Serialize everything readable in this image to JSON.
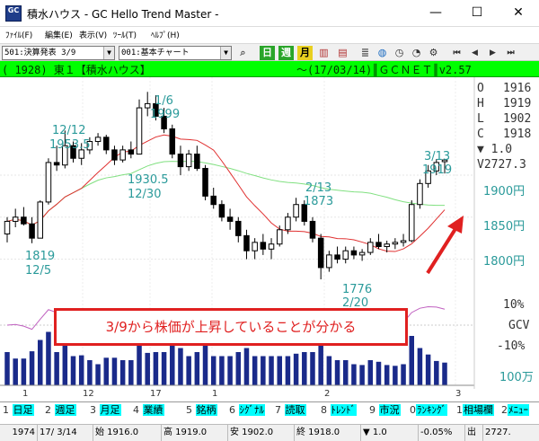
{
  "window": {
    "icon_text": "GC",
    "title": "積水ハウス - GC Hello Trend Master -",
    "minimize": "—",
    "maximize": "☐",
    "close": "✕"
  },
  "menu": {
    "file": "ﾌｧｲﾙ(F)",
    "edit": "編集(E)",
    "view": "表示(V)",
    "tools": "ﾂｰﾙ(T)",
    "help": "ﾍﾙﾌﾟ(H)"
  },
  "toolbar": {
    "list_select": "501:決算発表 3/9",
    "chart_select": "001:基本チャート",
    "day": "日",
    "week": "週",
    "month": "月",
    "nav_first": "⏮",
    "nav_prev": "◀",
    "nav_next": "▶",
    "nav_last": "⏭"
  },
  "infobar": {
    "code": "( 1928) 東１【積水ハウス】",
    "date": "〜(17/03/14)║ＧＣＮＥＴ║v2.57"
  },
  "chart": {
    "annotations": {
      "high_1": "12/12",
      "high_1_val": "1953.5",
      "peak": "1/6",
      "peak_val": "1999",
      "mid_val": "1930.5",
      "mid_date": "12/30",
      "feb13": "2/13",
      "feb13_val": "1873",
      "low_left_val": "1819",
      "low_left_date": "12/5",
      "low_feb_val": "1776",
      "low_feb_date": "2/20",
      "last": "3/13",
      "last_val": "1919"
    },
    "ohlc": {
      "o_label": "O",
      "o_val": "1916",
      "h_label": "H",
      "h_val": "1919",
      "l_label": "L",
      "l_val": "1902",
      "c_label": "C",
      "c_val": "1918",
      "change": "▼     1.0",
      "volume": "V2727.3"
    },
    "price_axis": [
      "1900円",
      "1850円",
      "1800円"
    ],
    "osc_axis": [
      "10%",
      "GCV",
      "-10%"
    ],
    "volume_unit": "100万",
    "time_axis": [
      "1",
      "12",
      "17",
      "1",
      "2",
      "3"
    ],
    "callout": "3/9から株価が上昇していることが分かる",
    "colors": {
      "up": "#ffffff",
      "down": "#000000",
      "ma_short": "#e03030",
      "ma_long": "#80e080",
      "volume": "#1a2a8a",
      "arrow": "#e02020"
    }
  },
  "chart_data": {
    "type": "candlestick",
    "series": [
      {
        "name": "ohlc",
        "values": [
          [
            1830,
            1850,
            1820,
            1845
          ],
          [
            1845,
            1860,
            1838,
            1850
          ],
          [
            1850,
            1862,
            1840,
            1842
          ],
          [
            1842,
            1850,
            1819,
            1825
          ],
          [
            1825,
            1870,
            1825,
            1868
          ],
          [
            1868,
            1920,
            1865,
            1915
          ],
          [
            1915,
            1935,
            1905,
            1912
          ],
          [
            1912,
            1953,
            1908,
            1935
          ],
          [
            1935,
            1940,
            1915,
            1920
          ],
          [
            1920,
            1938,
            1912,
            1930
          ],
          [
            1930,
            1945,
            1925,
            1940
          ],
          [
            1940,
            1950,
            1935,
            1945
          ],
          [
            1945,
            1948,
            1925,
            1930
          ],
          [
            1930,
            1935,
            1912,
            1918
          ],
          [
            1918,
            1935,
            1915,
            1930
          ],
          [
            1930,
            1940,
            1920,
            1925
          ],
          [
            1925,
            1990,
            1925,
            1980
          ],
          [
            1980,
            1999,
            1970,
            1985
          ],
          [
            1985,
            1995,
            1965,
            1970
          ],
          [
            1970,
            1980,
            1950,
            1955
          ],
          [
            1955,
            1960,
            1920,
            1925
          ],
          [
            1925,
            1935,
            1900,
            1910
          ],
          [
            1910,
            1930,
            1905,
            1925
          ],
          [
            1925,
            1935,
            1905,
            1908
          ],
          [
            1908,
            1912,
            1870,
            1875
          ],
          [
            1875,
            1885,
            1860,
            1865
          ],
          [
            1865,
            1870,
            1845,
            1850
          ],
          [
            1850,
            1860,
            1835,
            1845
          ],
          [
            1845,
            1850,
            1820,
            1828
          ],
          [
            1828,
            1835,
            1800,
            1810
          ],
          [
            1810,
            1825,
            1800,
            1820
          ],
          [
            1820,
            1830,
            1805,
            1812
          ],
          [
            1812,
            1825,
            1800,
            1818
          ],
          [
            1818,
            1840,
            1815,
            1835
          ],
          [
            1835,
            1855,
            1830,
            1850
          ],
          [
            1850,
            1873,
            1845,
            1865
          ],
          [
            1865,
            1870,
            1840,
            1845
          ],
          [
            1845,
            1850,
            1820,
            1825
          ],
          [
            1825,
            1830,
            1776,
            1790
          ],
          [
            1790,
            1810,
            1785,
            1805
          ],
          [
            1805,
            1815,
            1795,
            1800
          ],
          [
            1800,
            1815,
            1795,
            1810
          ],
          [
            1810,
            1815,
            1800,
            1805
          ],
          [
            1805,
            1812,
            1798,
            1808
          ],
          [
            1808,
            1825,
            1805,
            1820
          ],
          [
            1820,
            1830,
            1812,
            1815
          ],
          [
            1815,
            1822,
            1808,
            1818
          ],
          [
            1818,
            1825,
            1812,
            1820
          ],
          [
            1820,
            1830,
            1815,
            1822
          ],
          [
            1822,
            1870,
            1820,
            1865
          ],
          [
            1865,
            1895,
            1860,
            1890
          ],
          [
            1890,
            1912,
            1885,
            1905
          ],
          [
            1905,
            1919,
            1900,
            1915
          ],
          [
            1916,
            1919,
            1902,
            1918
          ]
        ]
      }
    ],
    "xlabel": "",
    "ylabel": "",
    "ylim": [
      1760,
      2010
    ]
  },
  "tabs": [
    {
      "num": "1",
      "label": "日足"
    },
    {
      "num": "2",
      "label": "週足"
    },
    {
      "num": "3",
      "label": "月足"
    },
    {
      "num": "4",
      "label": "業績"
    },
    {
      "num": "5",
      "label": "銘柄"
    },
    {
      "num": "6",
      "label": "ｼｸﾞﾅﾙ"
    },
    {
      "num": "7",
      "label": "読取"
    },
    {
      "num": "8",
      "label": "ﾄﾚﾝﾄﾞ"
    },
    {
      "num": "9",
      "label": "市況"
    },
    {
      "num": "0",
      "label": "ﾗﾝｷﾝｸﾞ"
    },
    {
      "num": "1",
      "label": "相場欄"
    },
    {
      "num": "2",
      "label": "ﾒﾆｭｰ"
    }
  ],
  "status": {
    "count": "1974",
    "date": "17/ 3/14",
    "open": "始  1916.0",
    "high": "高  1919.0",
    "low": "安  1902.0",
    "close": "終  1918.0",
    "change": "▼   1.0",
    "pct": "-0.05%",
    "vol_label": "出",
    "vol": "2727."
  }
}
